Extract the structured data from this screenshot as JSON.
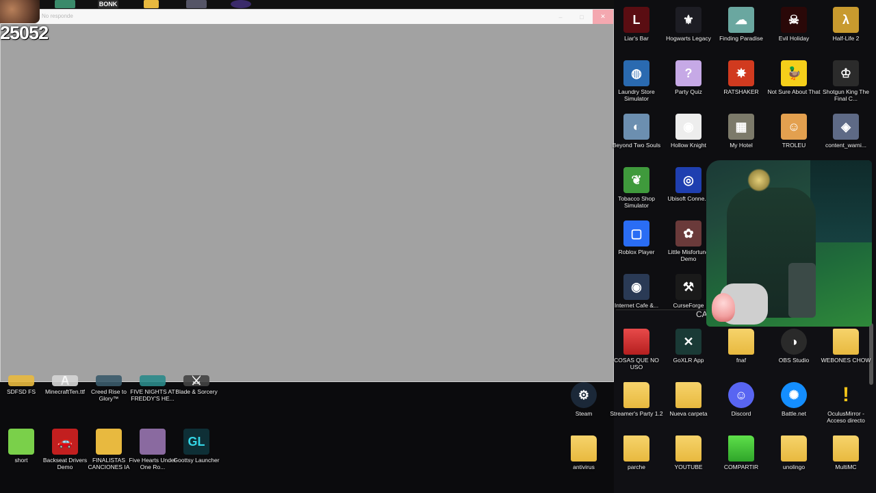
{
  "window": {
    "title": "No responde",
    "buttons": {
      "minimize": "–",
      "maximize": "□",
      "close": "✕"
    }
  },
  "overlay": {
    "counter": "25052",
    "top_strip_text": "BONK"
  },
  "right_panel": {
    "icons": [
      {
        "label": "Liar's Bar",
        "icon": "liars-bar-icon",
        "color": "#5a0d12",
        "glyph": "L"
      },
      {
        "label": "Hogwarts Legacy",
        "icon": "hogwarts-legacy-icon",
        "color": "#1d1d24",
        "glyph": "⚜"
      },
      {
        "label": "Finding Paradise",
        "icon": "finding-paradise-icon",
        "color": "#6aa7a0",
        "glyph": "☁"
      },
      {
        "label": "Evil Holiday",
        "icon": "evil-holiday-icon",
        "color": "#2a0808",
        "glyph": "☠"
      },
      {
        "label": "Half-Life 2",
        "icon": "half-life-2-icon",
        "color": "#c89a2e",
        "glyph": "λ"
      },
      {
        "label": "Laundry Store Simulator",
        "icon": "laundry-store-icon",
        "color": "#2a6ab0",
        "glyph": "◍"
      },
      {
        "label": "Party Quiz",
        "icon": "party-quiz-icon",
        "color": "#c6a9e6",
        "glyph": "?"
      },
      {
        "label": "RATSHAKER",
        "icon": "ratshaker-icon",
        "color": "#d13a1f",
        "glyph": "✸"
      },
      {
        "label": "Not Sure About That",
        "icon": "duck-icon",
        "color": "#f5cf1a",
        "glyph": "🦆"
      },
      {
        "label": "Shotgun King The Final C...",
        "icon": "shotgun-king-icon",
        "color": "#2b2b2b",
        "glyph": "♔"
      },
      {
        "label": "Beyond Two Souls",
        "icon": "beyond-two-souls-icon",
        "color": "#6c8fb0",
        "glyph": "◐"
      },
      {
        "label": "Hollow Knight",
        "icon": "hollow-knight-icon",
        "color": "#ededed",
        "glyph": "◉"
      },
      {
        "label": "My Hotel",
        "icon": "my-hotel-icon",
        "color": "#7c7a6a",
        "glyph": "▦"
      },
      {
        "label": "TROLEU",
        "icon": "troleu-icon",
        "color": "#e3a04f",
        "glyph": "☺"
      },
      {
        "label": "content_warni...",
        "icon": "content-warning-icon",
        "color": "#5e6a86",
        "glyph": "◈"
      },
      {
        "label": "Tobacco Shop Simulator",
        "icon": "tobacco-shop-icon",
        "color": "#3f9a3c",
        "glyph": "❦"
      },
      {
        "label": "Ubisoft Conne...",
        "icon": "ubisoft-connect-icon",
        "color": "#1f3fb0",
        "glyph": "◎"
      },
      {
        "label": "Roblox Player",
        "icon": "roblox-icon",
        "color": "#2a6df4",
        "glyph": "▢"
      },
      {
        "label": "Little Misfortune Demo",
        "icon": "little-misfortune-icon",
        "color": "#6a3a3a",
        "glyph": "✿"
      },
      {
        "label": "Internet Cafe &...",
        "icon": "internet-cafe-icon",
        "color": "#2a3a55",
        "glyph": "◉"
      },
      {
        "label": "CurseForge",
        "icon": "curseforge-icon",
        "color": "#1a1a1a",
        "glyph": "⚒"
      }
    ],
    "divider_label": "CAR",
    "divider_close": "✕"
  },
  "lower_right": {
    "icons": [
      {
        "label": "COSAS QUE NO USO",
        "icon": "folder-icon",
        "kind": "folder-red"
      },
      {
        "label": "GoXLR App",
        "icon": "goxlr-icon",
        "kind": "app",
        "color": "#1a3a36",
        "glyph": "✕"
      },
      {
        "label": "fnaf",
        "icon": "folder-icon",
        "kind": "folder"
      },
      {
        "label": "OBS Studio",
        "icon": "obs-icon",
        "kind": "app",
        "color": "#2a2a2a",
        "glyph": "◑"
      },
      {
        "label": "WEBONES CHOW",
        "icon": "folder-icon",
        "kind": "folder"
      },
      {
        "label": "Steam",
        "icon": "steam-icon",
        "kind": "app",
        "color": "#1b2838",
        "glyph": "⚙"
      },
      {
        "label": "Streamer's Party 1.2",
        "icon": "folder-icon",
        "kind": "folder"
      },
      {
        "label": "Nueva carpeta",
        "icon": "folder-icon",
        "kind": "folder"
      },
      {
        "label": "Discord",
        "icon": "discord-icon",
        "kind": "app",
        "color": "#5865f2",
        "glyph": "☺"
      },
      {
        "label": "Battle.net",
        "icon": "battlenet-icon",
        "kind": "app",
        "color": "#148eff",
        "glyph": "✺"
      },
      {
        "label": "OculusMirror - Acceso directo",
        "icon": "warning-icon",
        "kind": "app",
        "color": "#f5c518",
        "glyph": "!"
      },
      {
        "label": "antivirus",
        "icon": "folder-icon",
        "kind": "folder"
      },
      {
        "label": "parche",
        "icon": "folder-icon",
        "kind": "folder"
      },
      {
        "label": "YOUTUBE",
        "icon": "folder-icon",
        "kind": "folder"
      },
      {
        "label": "COMPARTIR",
        "icon": "folder-icon",
        "kind": "folder-green"
      },
      {
        "label": "unolingo",
        "icon": "folder-icon",
        "kind": "folder"
      },
      {
        "label": "MultiMC",
        "icon": "folder-icon",
        "kind": "folder"
      }
    ]
  },
  "lower_left": {
    "icons": [
      {
        "label": "SDFSD FS",
        "icon": "folder-icon"
      },
      {
        "label": "MinecraftTen.ttf",
        "icon": "font-file-icon"
      },
      {
        "label": "Creed Rise to Glory™",
        "icon": "creed-icon"
      },
      {
        "label": "FIVE NIGHTS AT FREDDY'S HE...",
        "icon": "fnaf-help-wanted-icon"
      },
      {
        "label": "Blade & Sorcery",
        "icon": "blade-sorcery-icon"
      },
      {
        "label": "short",
        "icon": "folder-icon"
      },
      {
        "label": "Backseat Drivers Demo",
        "icon": "backseat-drivers-icon"
      },
      {
        "label": "FINALISTAS CANCIONES IA",
        "icon": "folder-icon"
      },
      {
        "label": "Five Hearts Under One Ro...",
        "icon": "five-hearts-icon"
      },
      {
        "label": "Goottsy Launcher",
        "icon": "goottsy-launcher-icon"
      }
    ]
  }
}
